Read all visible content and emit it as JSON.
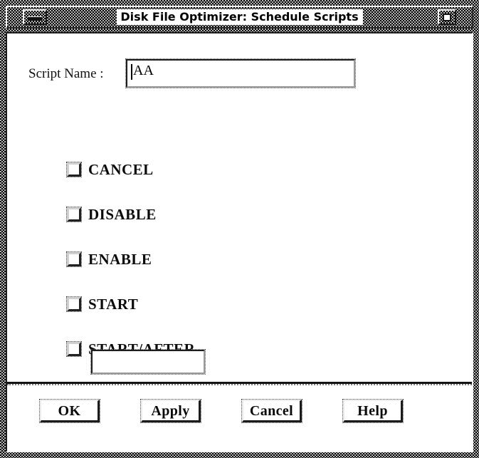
{
  "window": {
    "title": "Disk File Optimizer: Schedule Scripts",
    "minimize_icon": "minimize-icon",
    "maximize_icon": "maximize-icon",
    "frame_color": "#b4b4b4",
    "client_background": "#ffffff"
  },
  "form": {
    "script_name": {
      "label": "Script Name :",
      "value": "AA",
      "placeholder": ""
    },
    "options": [
      {
        "label": "CANCEL",
        "checked": false
      },
      {
        "label": "DISABLE",
        "checked": false
      },
      {
        "label": "ENABLE",
        "checked": false
      },
      {
        "label": "START",
        "checked": false
      },
      {
        "label": "START/AFTER",
        "checked": false
      }
    ],
    "after_field": {
      "value": "",
      "placeholder": ""
    }
  },
  "buttons": {
    "ok": "OK",
    "apply": "Apply",
    "cancel": "Cancel",
    "help": "Help"
  }
}
